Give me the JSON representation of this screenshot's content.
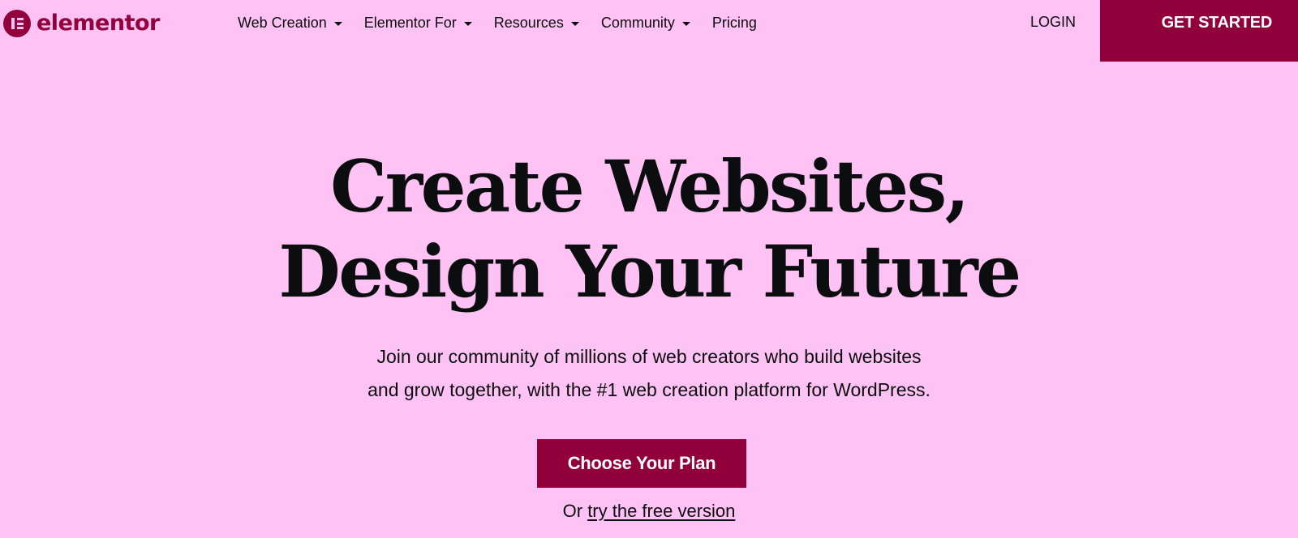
{
  "header": {
    "logo_text": "elementor",
    "nav": [
      {
        "label": "Web Creation",
        "has_dropdown": true
      },
      {
        "label": "Elementor For",
        "has_dropdown": true
      },
      {
        "label": "Resources",
        "has_dropdown": true
      },
      {
        "label": "Community",
        "has_dropdown": true
      },
      {
        "label": "Pricing",
        "has_dropdown": false
      }
    ],
    "login_label": "LOGIN",
    "get_started_label": "GET STARTED"
  },
  "hero": {
    "title_line1": "Create Websites,",
    "title_line2": "Design Your Future",
    "subtitle_line1": "Join our community of millions of web creators who build websites",
    "subtitle_line2": "and grow together, with the #1 web creation platform for WordPress.",
    "cta_label": "Choose Your Plan",
    "alt_prefix": "Or",
    "alt_link_label": "try the free version"
  },
  "colors": {
    "background": "#FFC2F5",
    "brand": "#92003B",
    "text": "#0c0d0e"
  },
  "icons": {
    "logo": "elementor-logo-icon",
    "dropdown": "caret-down-icon"
  }
}
